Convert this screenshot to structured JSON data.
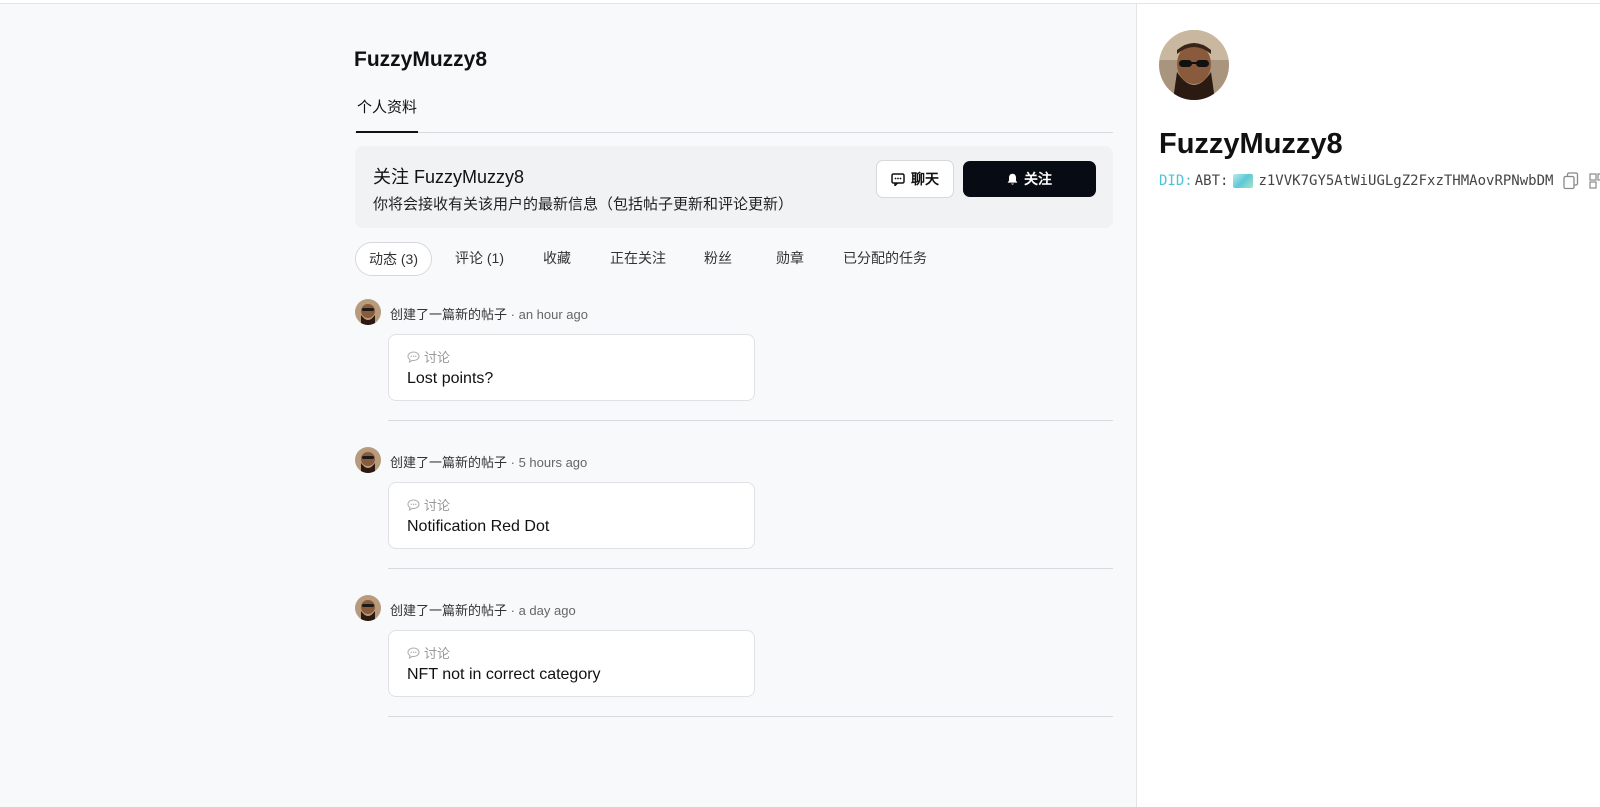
{
  "profile": {
    "username": "FuzzyMuzzy8",
    "tab_label": "个人资料"
  },
  "follow_box": {
    "title": "关注 FuzzyMuzzy8",
    "description": "你将会接收有关该用户的最新信息（包括帖子更新和评论更新）",
    "chat_label": "聊天",
    "follow_label": "关注"
  },
  "sub_tabs": [
    "动态 (3)",
    "评论 (1)",
    "收藏",
    "正在关注",
    "粉丝",
    "勋章",
    "已分配的任务"
  ],
  "feed": [
    {
      "action": "创建了一篇新的帖子",
      "time": "an hour ago",
      "category": "讨论",
      "title": "Lost points?"
    },
    {
      "action": "创建了一篇新的帖子",
      "time": "5 hours ago",
      "category": "讨论",
      "title": "Notification Red Dot"
    },
    {
      "action": "创建了一篇新的帖子",
      "time": "a day ago",
      "category": "讨论",
      "title": "NFT not in correct category"
    }
  ],
  "sidebar": {
    "name": "FuzzyMuzzy8",
    "did_label": "DID:",
    "did_prefix": "ABT:",
    "did_value": "z1VVK7GY5AtWiUGLgZ2FxzTHMAovRPNwbDM"
  },
  "colors": {
    "follow_button_bg": "#070b14",
    "did_label": "#4dc4d4"
  }
}
